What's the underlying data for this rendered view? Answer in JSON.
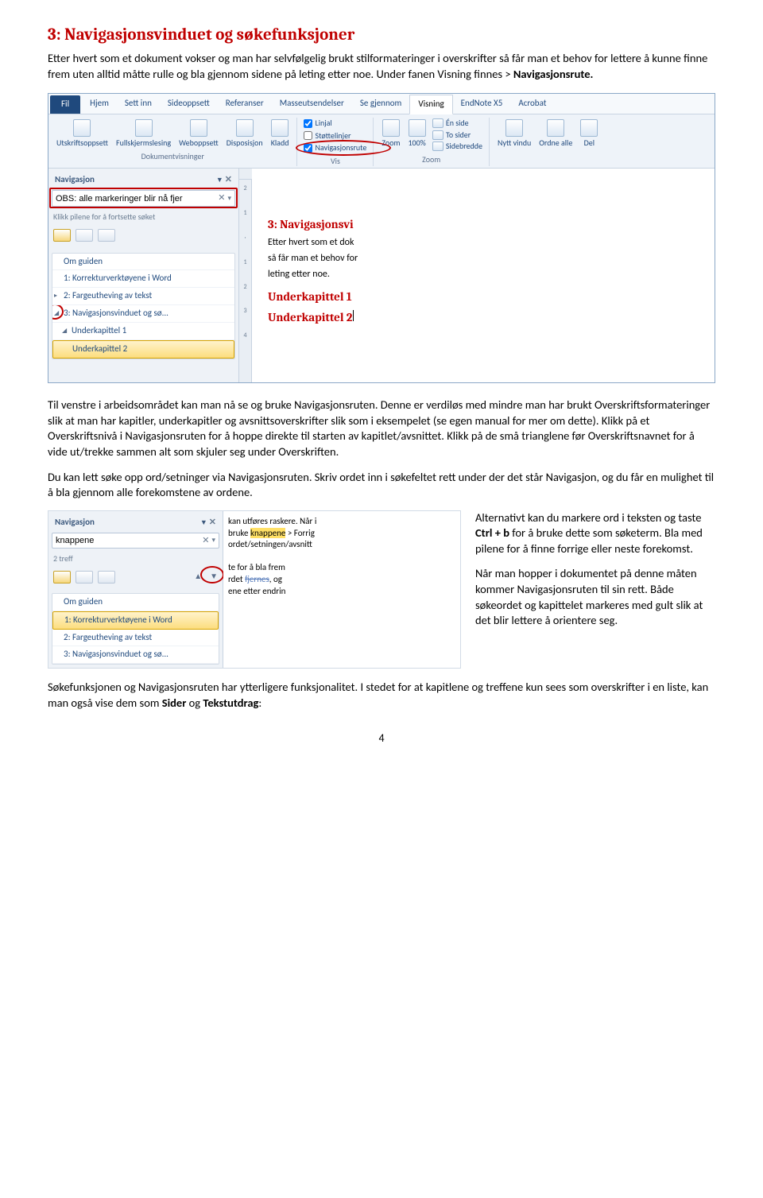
{
  "heading": "3: Navigasjonsvinduet og søkefunksjoner",
  "intro": "Etter hvert som et dokument vokser og man har selvfølgelig brukt stilformateringer i overskrifter så får man et behov for lettere å kunne finne frem uten alltid måtte rulle og bla gjennom sidene på leting etter noe. Under fanen Visning finnes > ",
  "intro_bold": "Navigasjonsrute.",
  "ribbon": {
    "tabs": [
      "Fil",
      "Hjem",
      "Sett inn",
      "Sideoppsett",
      "Referanser",
      "Masseutsendelser",
      "Se gjennom",
      "Visning",
      "EndNote X5",
      "Acrobat"
    ],
    "active_tab": "Visning",
    "group1_label": "Dokumentvisninger",
    "group1_btns": [
      "Utskriftsoppsett",
      "Fullskjermslesing",
      "Weboppsett",
      "Disposisjon",
      "Kladd"
    ],
    "group2_label": "Vis",
    "group2_checks": [
      "Linjal",
      "Støttelinjer",
      "Navigasjonsrute"
    ],
    "group3_label": "Zoom",
    "group3_btns": [
      "Zoom",
      "100%"
    ],
    "group4_items": [
      "Én side",
      "To sider",
      "Sidebredde"
    ],
    "group5_btns": [
      "Nytt vindu",
      "Ordne alle",
      "Del"
    ]
  },
  "nav1": {
    "title": "Navigasjon",
    "search_value": "OBS: alle markeringer blir nå fjer",
    "hint": "Klikk pilene for å fortsette søket",
    "items": [
      "Om guiden",
      "1: Korrekturverktøyene i Word",
      "2: Fargeutheving av tekst",
      "3: Navigasjonsvinduet og sø...",
      "Underkapittel 1",
      "Underkapittel 2"
    ],
    "selected": "Underkapittel 2"
  },
  "doc1": {
    "h": "3: Navigasjonsvi",
    "l1": "Etter hvert som et dok",
    "l2": "så får man et behov for",
    "l3": "leting etter noe.",
    "u1": "Underkapittel 1",
    "u2": "Underkapittel 2"
  },
  "para_after_fig1_a": "Til venstre i arbeidsområdet kan man nå se og bruke Navigasjonsruten. Denne er verdiløs med mindre man har brukt Overskriftsformateringer slik at man har kapitler, underkapitler og avsnittsoverskrifter slik som i eksempelet (se egen manual for mer om dette). Klikk på et Overskriftsnivå i Navigasjonsruten for å hoppe direkte til starten av kapitlet/avsnittet. Klikk på de små trianglene før Overskriftsnavnet for å vide ut/trekke sammen alt som skjuler seg under Overskriften.",
  "para_after_fig1_b": "Du kan lett søke opp ord/setninger via Navigasjonsruten. Skriv ordet inn i søkefeltet rett under der det står Navigasjon, og du får en mulighet til å bla gjennom alle forekomstene av ordene.",
  "nav2": {
    "title": "Navigasjon",
    "search_value": "knappene",
    "hits": "2 treff",
    "items": [
      "Om guiden",
      "1: Korrekturverktøyene i Word",
      "2: Fargeutheving av tekst",
      "3: Navigasjonsvinduet og sø..."
    ],
    "selected": "1: Korrekturverktøyene i Word"
  },
  "frag": {
    "l1": "kan utføres raskere. Når i",
    "l2a": "bruke ",
    "l2hl": "knappene",
    "l2b": " > Forrig",
    "l3": "ordet/setningen/avsnitt",
    "l4": "te for å bla frem",
    "l5a": "rdet ",
    "l5strike": "fjernes",
    "l5b": ", og",
    "l6": "ene etter endrin"
  },
  "right_paras": {
    "p1a": "Alternativt kan du markere ord i teksten og taste ",
    "p1b": "Ctrl + b",
    "p1c": " for å bruke dette som søketerm. Bla med pilene for å finne forrige eller neste forekomst.",
    "p2": "Når man hopper i dokumentet på denne måten kommer Navigasjonsruten til sin rett. Både søkeordet og kapittelet markeres med gult slik at det blir lettere å orientere seg."
  },
  "final_para_a": "Søkefunksjonen og Navigasjonsruten har ytterligere funksjonalitet. I stedet for at kapitlene og treffene kun sees som overskrifter i en liste, kan man også vise dem som ",
  "final_bold1": "Sider",
  "final_mid": " og ",
  "final_bold2": "Tekstutdrag",
  "final_colon": ":",
  "page_num": "4",
  "ruler_marks": "2 · 1 · · 1 · 1 · 2 · 3"
}
